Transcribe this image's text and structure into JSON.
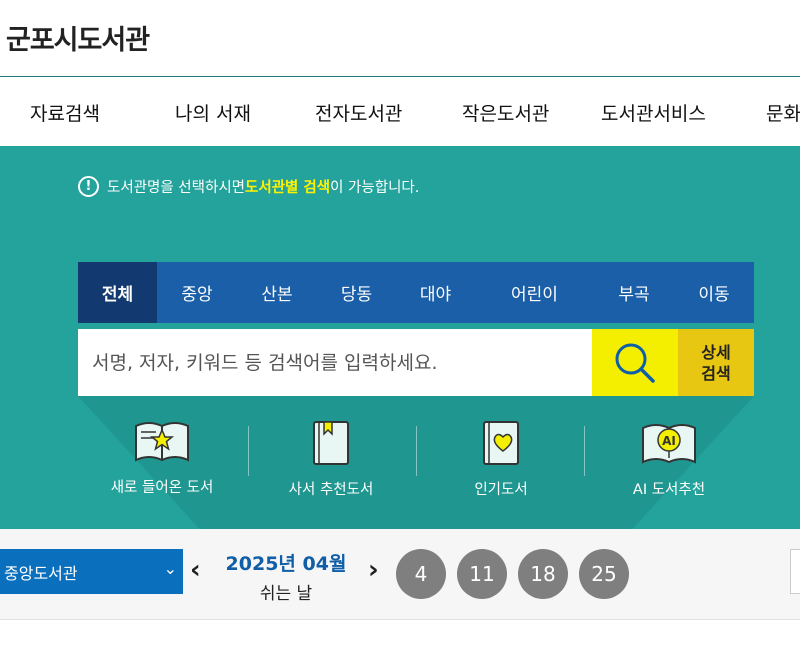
{
  "header": {
    "logo": "군포시도서관"
  },
  "gnb": [
    "자료검색",
    "나의 서재",
    "전자도서관",
    "작은도서관",
    "도서관서비스",
    "문화"
  ],
  "notice": {
    "icon": "exclamation-circle-icon",
    "before": "도서관명을 선택하시면 ",
    "highlight": "도서관별 검색",
    "after": "이 가능합니다."
  },
  "search": {
    "tabs": [
      "전체",
      "중앙",
      "산본",
      "당동",
      "대야",
      "어린이",
      "부곡",
      "이동"
    ],
    "active_tab": "전체",
    "placeholder": "서명, 저자, 키워드 등 검색어를 입력하세요.",
    "value": "",
    "search_icon": "magnifier-icon",
    "detail_line1": "상세",
    "detail_line2": "검색"
  },
  "quick_links": [
    {
      "label": "새로 들어온 도서",
      "icon": "open-book-star-icon"
    },
    {
      "label": "사서 추천도서",
      "icon": "bookmark-book-icon"
    },
    {
      "label": "인기도서",
      "icon": "heart-book-icon"
    },
    {
      "label": "AI 도서추천",
      "icon": "ai-book-icon"
    }
  ],
  "calendar": {
    "library_select": "중앙도서관",
    "month_title": "2025년 04월",
    "subtitle": "쉬는 날",
    "prev_icon": "chevron-left-icon",
    "next_icon": "chevron-right-icon",
    "closed_days": [
      "4",
      "11",
      "18",
      "25"
    ]
  },
  "colors": {
    "hero_bg": "#23a39b",
    "tab_bar": "#1a5fa8",
    "tab_active": "#123a70",
    "search_button": "#f4ef00",
    "detail_button": "#e8c712",
    "highlight_text": "#fff200",
    "select_bg": "#0a6fbc",
    "day_circle": "#7f7f7f"
  }
}
